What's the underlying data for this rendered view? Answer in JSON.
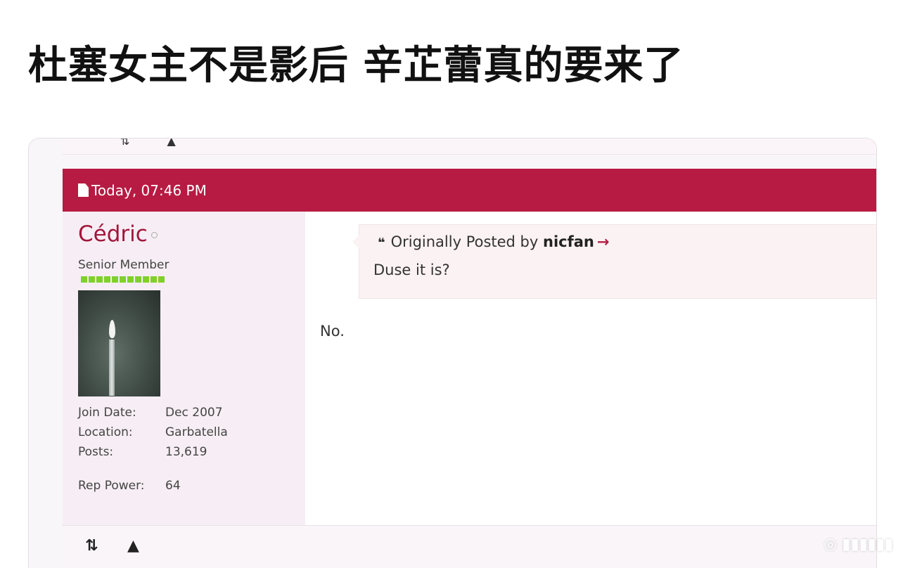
{
  "headline": "杜塞女主不是影后 辛芷蕾真的要来了",
  "post": {
    "timestamp": "Today, 07:46 PM",
    "user": {
      "name": "Cédric",
      "title": "Senior Member",
      "rep_pips": 11,
      "info": [
        {
          "label": "Join Date:",
          "value": "Dec 2007"
        },
        {
          "label": "Location:",
          "value": "Garbatella"
        },
        {
          "label": "Posts:",
          "value": "13,619"
        }
      ],
      "rep_power_label": "Rep Power:",
      "rep_power_value": "64"
    },
    "quote": {
      "prefix": "Originally Posted by",
      "author": "nicfan",
      "text": "Duse it is?"
    },
    "reply": "No."
  },
  "footer": {
    "icons": [
      "reply-arrows-icon",
      "report-warning-icon"
    ]
  },
  "colors": {
    "header_bg": "#b71a42",
    "username": "#a1163b",
    "rep_green": "#7fd02b"
  }
}
